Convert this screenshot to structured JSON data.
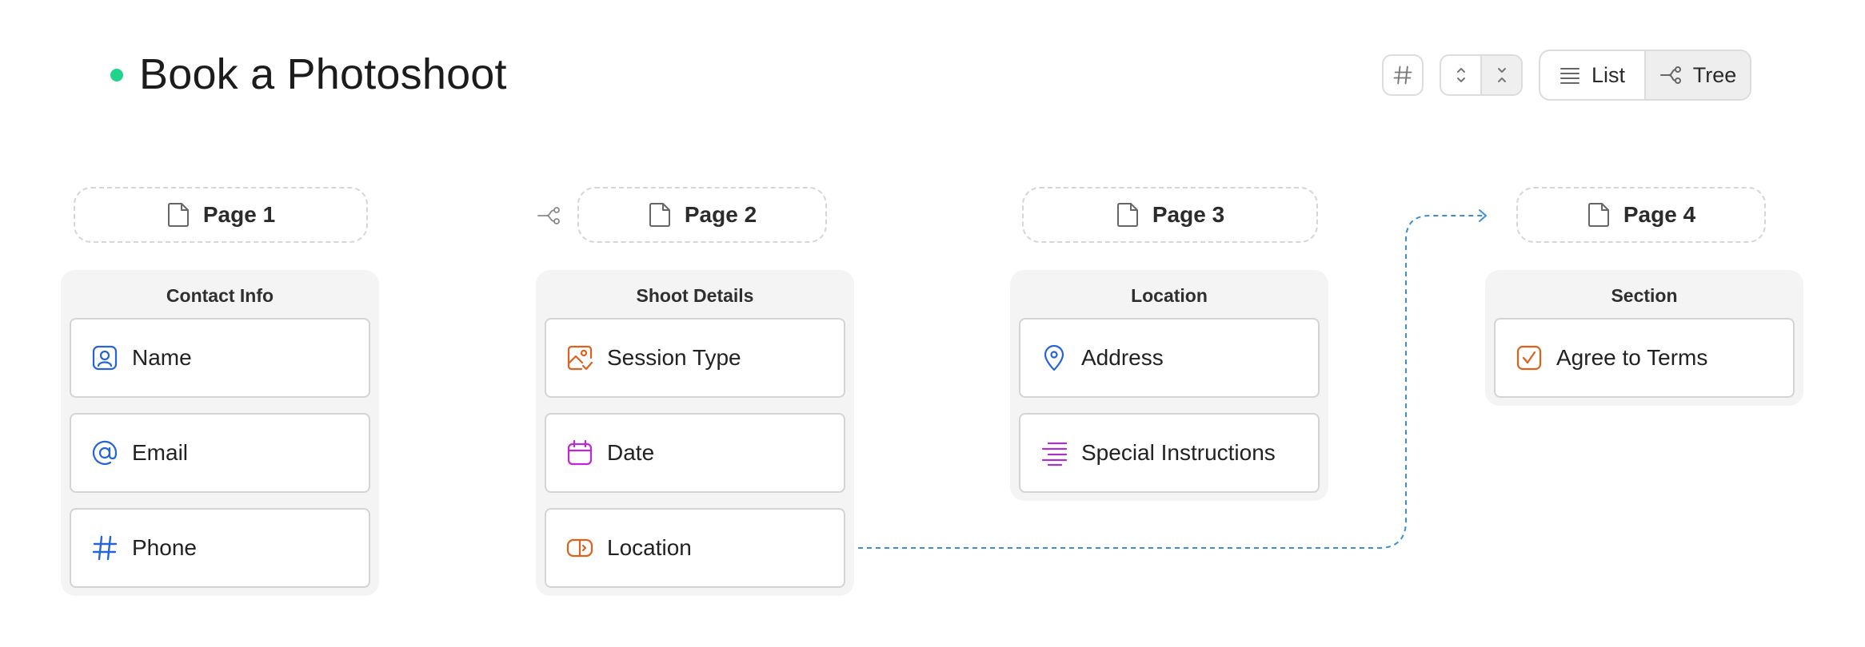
{
  "form": {
    "title": "Book a Photoshoot",
    "status_color": "#1fd48b"
  },
  "toolbar": {
    "hash_icon": "hash-icon",
    "stepper_up_icon": "chevrons-up-down-icon",
    "stepper_down_icon": "chevrons-collapse-icon",
    "view_options": [
      {
        "label": "List",
        "icon": "list-icon",
        "selected": false
      },
      {
        "label": "Tree",
        "icon": "tree-icon",
        "selected": true
      }
    ]
  },
  "pages": [
    {
      "label": "Page 1",
      "section": "Contact Info",
      "fields": [
        {
          "label": "Name",
          "icon": "contact-icon",
          "color": "#2563d8"
        },
        {
          "label": "Email",
          "icon": "at-sign-icon",
          "color": "#2563d8"
        },
        {
          "label": "Phone",
          "icon": "hash-icon",
          "color": "#2563d8"
        }
      ]
    },
    {
      "label": "Page 2",
      "section": "Shoot Details",
      "has_logic": true,
      "fields": [
        {
          "label": "Session Type",
          "icon": "image-check-icon",
          "color": "#e0611c"
        },
        {
          "label": "Date",
          "icon": "calendar-icon",
          "color": "#c026d3"
        },
        {
          "label": "Location",
          "icon": "toggle-icon",
          "color": "#e0611c"
        }
      ]
    },
    {
      "label": "Page 3",
      "section": "Location",
      "fields": [
        {
          "label": "Address",
          "icon": "map-pin-icon",
          "color": "#2563d8"
        },
        {
          "label": "Special Instructions",
          "icon": "text-lines-icon",
          "color": "#a535c9"
        }
      ]
    },
    {
      "label": "Page 4",
      "section": "Section",
      "fields": [
        {
          "label": "Agree to Terms",
          "icon": "checkbox-icon",
          "color": "#e0611c"
        }
      ]
    }
  ],
  "connector_color": "#3b8fd9"
}
